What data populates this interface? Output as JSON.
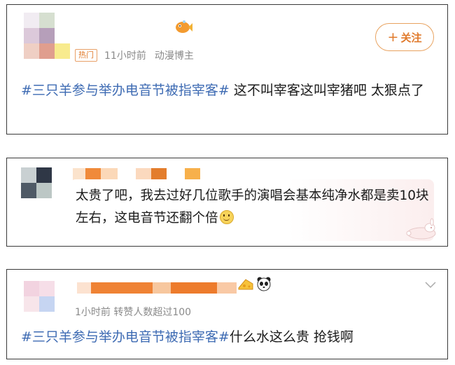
{
  "post1": {
    "hot_badge": "热门",
    "time": "11小时前",
    "user_type": "动漫博主",
    "follow_label": "关注",
    "follow_plus": "+",
    "hashtag": "#三只羊参与举办电音节被指宰客#",
    "text": " 这不叫宰客这叫宰猪吧 太狠点了",
    "badge_icon": "fish-icon"
  },
  "comment2": {
    "text": "太贵了吧，我去过好几位歌手的演唱会基本纯净水都是卖10块左右，这电音节还翻个倍"
  },
  "comment3": {
    "meta": "1小时前 转赞人数超过100",
    "hashtag": "#三只羊参与举办电音节被指宰客#",
    "text": "什么水这么贵 抢钱啊",
    "icons": [
      "cheese-icon",
      "panda-icon"
    ]
  }
}
